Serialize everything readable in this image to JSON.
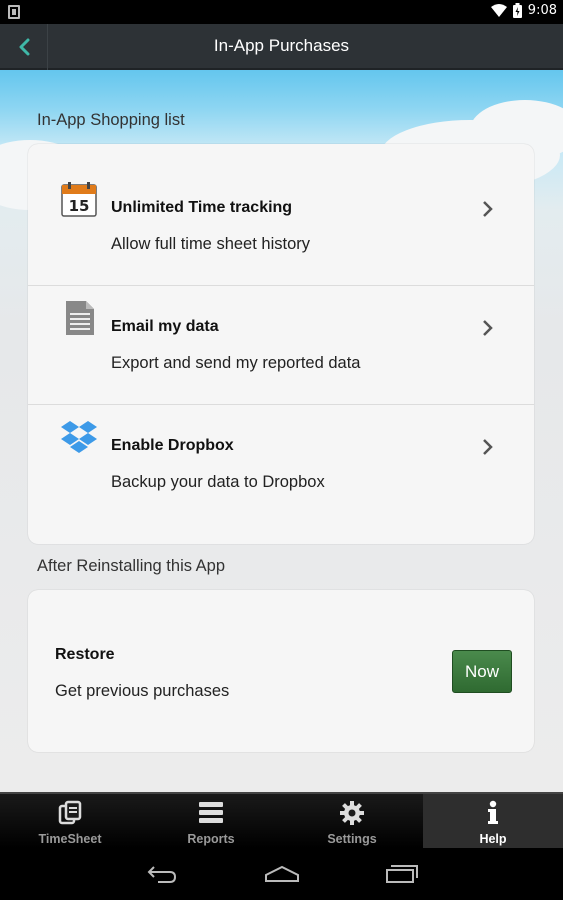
{
  "status_bar": {
    "time": "9:08"
  },
  "action_bar": {
    "title": "In-App Purchases",
    "back_icon": "chevron-left-icon",
    "accent": "#3fb8a8"
  },
  "shopping": {
    "section_label": "In-App Shopping list",
    "items": [
      {
        "title": "Unlimited Time tracking",
        "subtitle": "Allow full time sheet history",
        "icon": "calendar-icon",
        "icon_text": "15"
      },
      {
        "title": "Email my data",
        "subtitle": "Export and send my reported data",
        "icon": "document-icon"
      },
      {
        "title": "Enable Dropbox",
        "subtitle": "Backup your data to Dropbox",
        "icon": "dropbox-icon"
      }
    ]
  },
  "restore": {
    "section_label": "After Reinstalling this App",
    "title": "Restore",
    "subtitle": "Get previous purchases",
    "button_label": "Now",
    "button_color": "#3a7a3c"
  },
  "tabs": [
    {
      "label": "TimeSheet",
      "icon": "timesheet-icon",
      "active": false
    },
    {
      "label": "Reports",
      "icon": "reports-icon",
      "active": false
    },
    {
      "label": "Settings",
      "icon": "gear-icon",
      "active": false
    },
    {
      "label": "Help",
      "icon": "info-icon",
      "active": true
    }
  ],
  "nav": [
    "back-nav-icon",
    "home-nav-icon",
    "recents-nav-icon"
  ]
}
